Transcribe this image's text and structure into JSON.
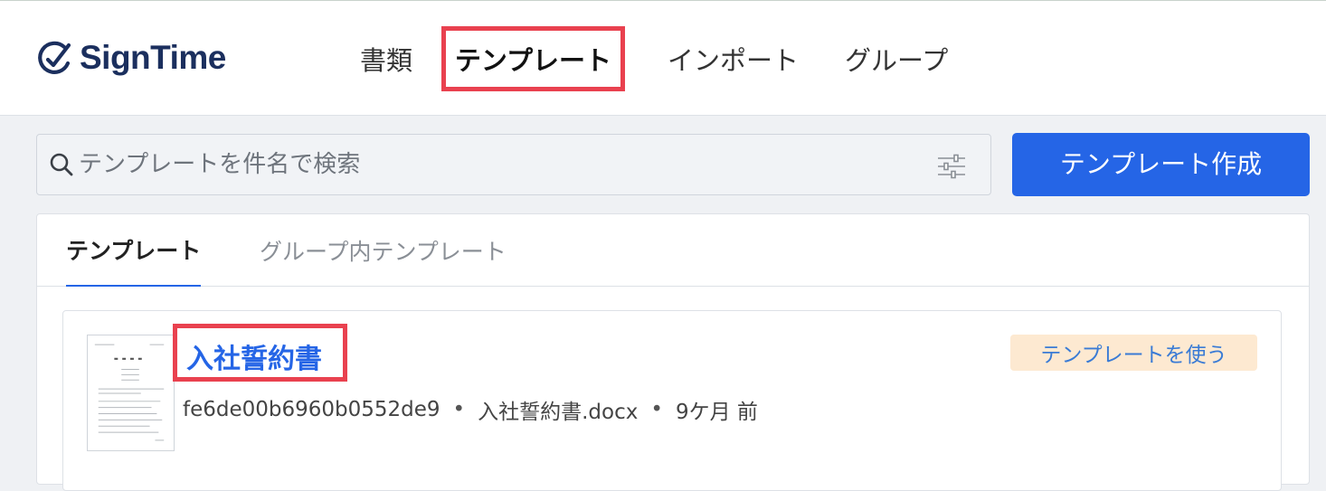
{
  "app": {
    "name": "SignTime",
    "brand_color": "#1b2f5e",
    "accent_color": "#2565e6",
    "highlight_color": "#e9414f"
  },
  "nav": {
    "items": [
      {
        "label": "書類",
        "active": false
      },
      {
        "label": "テンプレート",
        "active": true
      },
      {
        "label": "インポート",
        "active": false
      },
      {
        "label": "グループ",
        "active": false
      }
    ]
  },
  "search": {
    "placeholder": "テンプレートを件名で検索",
    "value": "",
    "search_icon": "search-icon",
    "filter_icon": "sliders-icon"
  },
  "toolbar": {
    "create_label": "テンプレート作成"
  },
  "tabs": [
    {
      "label": "テンプレート",
      "active": true
    },
    {
      "label": "グループ内テンプレート",
      "active": false
    }
  ],
  "templates": [
    {
      "title": "入社誓約書",
      "id": "fe6de00b6960b0552de9",
      "file": "入社誓約書.docx",
      "updated": "9ケ月 前",
      "use_label": "テンプレートを使う",
      "separator": "•"
    }
  ]
}
